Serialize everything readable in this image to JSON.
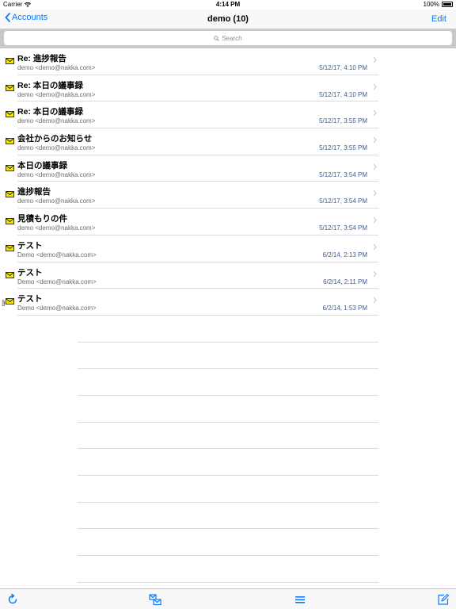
{
  "status_bar": {
    "carrier": "Carrier",
    "time": "4:14 PM",
    "battery": "100%"
  },
  "nav": {
    "back_label": "Accounts",
    "title": "demo (10)",
    "edit_label": "Edit"
  },
  "search": {
    "placeholder": "Search"
  },
  "colors": {
    "accent": "#0a7aff",
    "date_text": "#3f5b8c",
    "envelope": "#f5e600"
  },
  "messages": [
    {
      "subject": "Re: 進捗報告",
      "sender": "demo <demo@nakka.com>",
      "date": "5/12/17, 4:10 PM"
    },
    {
      "subject": "Re: 本日の議事録",
      "sender": "demo <demo@nakka.com>",
      "date": "5/12/17, 4:10 PM"
    },
    {
      "subject": "Re: 本日の議事録",
      "sender": "demo <demo@nakka.com>",
      "date": "5/12/17, 3:55 PM"
    },
    {
      "subject": "会社からのお知らせ",
      "sender": "demo <demo@nakka.com>",
      "date": "5/12/17, 3:55 PM"
    },
    {
      "subject": "本日の議事録",
      "sender": "demo <demo@nakka.com>",
      "date": "5/12/17, 3:54 PM"
    },
    {
      "subject": "進捗報告",
      "sender": "demo <demo@nakka.com>",
      "date": "5/12/17, 3:54 PM"
    },
    {
      "subject": "見積もりの件",
      "sender": "demo <demo@nakka.com>",
      "date": "5/12/17, 3:54 PM"
    },
    {
      "subject": "テスト",
      "sender": "Demo <demo@nakka.com>",
      "date": "6/2/14, 2:13 PM"
    },
    {
      "subject": "テスト",
      "sender": "Demo <demo@nakka.com>",
      "date": "6/2/14, 2:11 PM"
    },
    {
      "subject": "テスト",
      "sender": "Demo <demo@nakka.com>",
      "date": "6/2/14, 1:53 PM",
      "attachment": true
    }
  ],
  "toolbar": {
    "icons": [
      "refresh-icon",
      "move-messages-icon",
      "menu-icon",
      "compose-icon"
    ]
  }
}
